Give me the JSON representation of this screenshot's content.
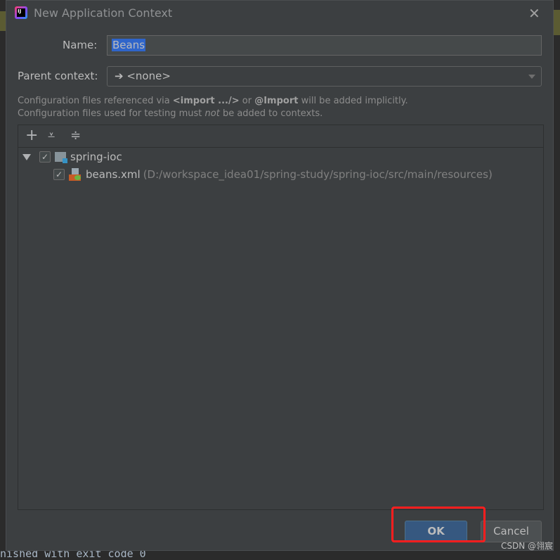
{
  "dialog": {
    "title": "New Application Context",
    "name_label": "Name:",
    "name_value": "Beans",
    "parent_label": "Parent context:",
    "parent_value": "<none>",
    "info_line1_pre": "Configuration files referenced via ",
    "info_line1_b1": "<import .../>",
    "info_line1_mid": " or ",
    "info_line1_b2": "@Import",
    "info_line1_post": " will be added implicitly.",
    "info_line2_pre": "Configuration files used for testing must ",
    "info_line2_em": "not",
    "info_line2_post": " be added to contexts.",
    "toolbar": {
      "add": "+",
      "expand": "⩡",
      "collapse": "≑"
    },
    "tree": {
      "module": {
        "label": "spring-ioc",
        "checked": true,
        "expanded": true
      },
      "file": {
        "label": "beans.xml",
        "path": "(D:/workspace_idea01/spring-study/spring-ioc/src/main/resources)",
        "checked": true
      }
    },
    "ok_label": "OK",
    "cancel_label": "Cancel"
  },
  "background": {
    "console_text": "nished with exit code 0"
  },
  "watermark": "CSDN @翎宸",
  "colors": {
    "accent": "#365880",
    "highlight": "#ff1e1e",
    "selection": "#2f65ca"
  }
}
